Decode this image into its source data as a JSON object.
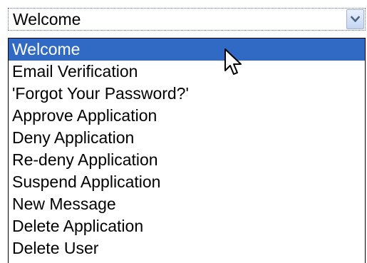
{
  "select": {
    "value": "Welcome",
    "arrow_icon": "chevron-down-icon"
  },
  "dropdown": {
    "selected_index": 0,
    "options": [
      "Welcome",
      "Email Verification",
      "'Forgot Your Password?'",
      "Approve Application",
      "Deny Application",
      "Re-deny Application",
      "Suspend Application",
      "New Message",
      "Delete Application",
      "Delete User"
    ]
  },
  "colors": {
    "highlight": "#316ac5",
    "highlight_text": "#ffffff",
    "arrow": "#4d6185"
  },
  "cursor_icon": "mouse-pointer-icon"
}
